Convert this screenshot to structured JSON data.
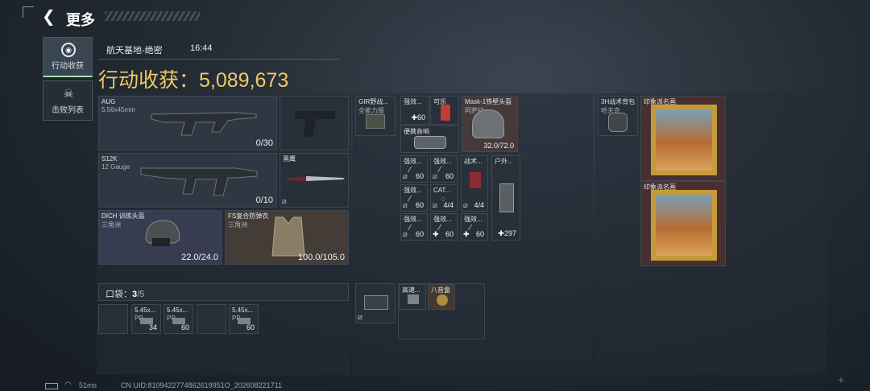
{
  "header": {
    "back_title": "更多"
  },
  "sidebar": [
    {
      "label": "行动收获",
      "icon": "coin-icon",
      "active": true
    },
    {
      "label": "击败列表",
      "icon": "skull-icon",
      "active": false
    }
  ],
  "match": {
    "map": "航天基地-绝密",
    "time": "16:44"
  },
  "loot": {
    "title_prefix": "行动收获：",
    "value": "5,089,673"
  },
  "weapons": [
    {
      "name": "AUG",
      "ammo_type": "5.56x45mm",
      "ammo": "0/30"
    },
    {
      "name": "S12K",
      "ammo_type": "12 Gauge",
      "ammo": "0/10"
    }
  ],
  "knife": {
    "name": "黑鹰"
  },
  "helmet": {
    "name": "DICH 训练头盔",
    "sub": "三角洲",
    "durability": "22.0/24.0"
  },
  "armor": {
    "name": "FS复合防弹衣",
    "sub": "三角洲",
    "durability": "100.0/105.0"
  },
  "pocket": {
    "label": "口袋：",
    "count": "3",
    "total": "/5",
    "items": [
      {
        "name": "5.45x...",
        "sub": "PP",
        "qty": "34"
      },
      {
        "name": "5.45x...",
        "sub": "PP",
        "qty": "60"
      },
      {
        "name": "",
        "sub": "",
        "qty": ""
      },
      {
        "name": "5.45x...",
        "sub": "PP",
        "qty": "60"
      }
    ]
  },
  "rig": {
    "name": "GIR野战...",
    "sub": "全能力服"
  },
  "rig_items": {
    "a": {
      "name": "强效...",
      "qty": "60"
    },
    "b": {
      "name": "可乐"
    },
    "c": {
      "name": "便携音响"
    },
    "mask": {
      "name": "Mask-1铁壁头盔",
      "sub": "阿萨拉",
      "durability": "32.0/72.0"
    }
  },
  "meds_grid": [
    {
      "name": "强效...",
      "qty": "60"
    },
    {
      "name": "强效...",
      "qty": "60"
    },
    {
      "name": "强效...",
      "qty": "60"
    },
    {
      "name": "CAT...",
      "qty": "4/4"
    },
    {
      "name": "强效...",
      "qty": "60"
    },
    {
      "name": "强效...",
      "qty": "60"
    },
    {
      "name": "强效...",
      "qty": "60"
    }
  ],
  "tactical": {
    "name": "战术...",
    "qty": "4/4"
  },
  "outdoor": {
    "name": "户外...",
    "qty": "297"
  },
  "case": {
    "items": [
      {
        "name": "高速..."
      },
      {
        "name": "八音盒"
      }
    ]
  },
  "backpack": {
    "name": "3H战术背包",
    "sub": "哈夫克"
  },
  "paintings": [
    {
      "name": "印象派名画"
    },
    {
      "name": "印象派名画"
    }
  ],
  "footer": {
    "ping": "51ms",
    "uid": "CN UID:8109422774862619951O_202608221711"
  }
}
